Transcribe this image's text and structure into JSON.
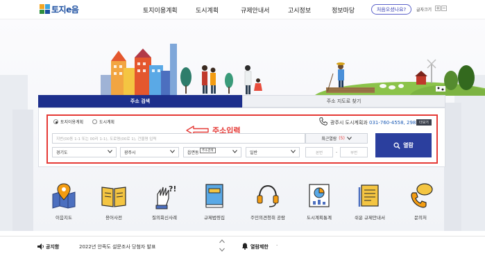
{
  "header": {
    "logo_text": "토지e음",
    "nav": [
      "토지이용계획",
      "도시계획",
      "규제안내서",
      "고시정보",
      "정보마당"
    ],
    "visit_button": "처음오셨나요?",
    "font_size_label": "글자크기",
    "font_plus": "+",
    "font_minus": "−"
  },
  "tabs": {
    "active": "주소 검색",
    "inactive": "주소 지도로 찾기"
  },
  "search": {
    "radio_land": "토지이용계획",
    "radio_city": "도시계획",
    "selected_radio": "토지이용계획",
    "annotation": "주소입력",
    "contact_label": "광주시 도시계획과",
    "contact_number": "031-760-4558, 2983",
    "more_button": "더보기",
    "address_placeholder": "지번(00동 1-1 또는 00리 1-1), 도로명(00로 1), 건물명 입력",
    "recent_label": "최근열람",
    "recent_count": "(5)",
    "search_button": "열람",
    "sido": "경기도",
    "sigungu": "광주시",
    "eupmyeondong": "읍면동",
    "tooltip": "주소검색",
    "type": "일반",
    "main_num_placeholder": "본번",
    "sub_num_placeholder": "부번",
    "dash": "-"
  },
  "quick_menu": [
    {
      "label": "이음지도",
      "icon": "map-pin-icon"
    },
    {
      "label": "용어사전",
      "icon": "book-icon"
    },
    {
      "label": "질의회신사례",
      "icon": "question-hand-icon"
    },
    {
      "label": "규제법령집",
      "icon": "law-book-icon"
    },
    {
      "label": "주민의견청취 공람",
      "icon": "headset-icon"
    },
    {
      "label": "도시계획통계",
      "icon": "statistics-icon"
    },
    {
      "label": "쉬운 규제안내서",
      "icon": "guide-doc-icon"
    },
    {
      "label": "문의처",
      "icon": "phone-chat-icon"
    }
  ],
  "footer": {
    "notice_label": "공지함",
    "notice_text": "2022년 안족도 설문조사 당첨자 발표",
    "limit_label": "열람제한",
    "dot": "·"
  },
  "colors": {
    "primary": "#1d2f8c",
    "accent_red": "#e53935",
    "link_blue": "#1d5bb5"
  }
}
